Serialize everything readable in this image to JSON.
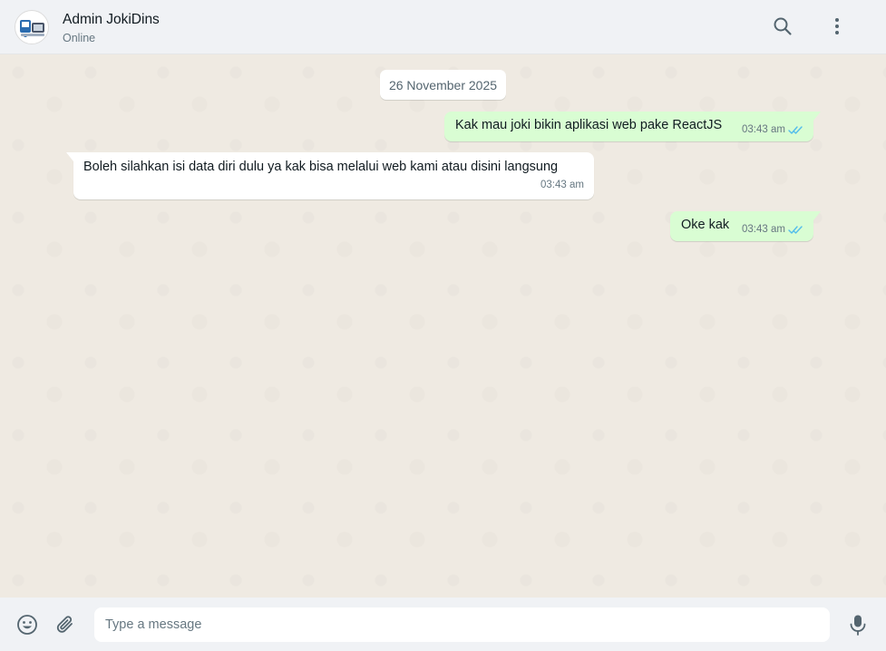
{
  "header": {
    "contact_name": "Admin JokiDins",
    "status": "Online",
    "avatar_icon": "avatar-logo-icon",
    "search_icon": "search-icon",
    "menu_icon": "kebab-menu-icon"
  },
  "chat": {
    "date_divider": "26 November 2025",
    "messages": [
      {
        "direction": "outgoing",
        "text": "Kak mau joki bikin aplikasi web pake ReactJS",
        "time": "03:43 am",
        "read": true
      },
      {
        "direction": "incoming",
        "text": "Boleh silahkan isi data diri dulu ya kak bisa melalui web kami atau disini langsung",
        "time": "03:43 am"
      },
      {
        "direction": "outgoing",
        "text": "Oke kak",
        "time": "03:43 am",
        "read": true
      }
    ]
  },
  "composer": {
    "placeholder": "Type a message",
    "value": "",
    "emoji_icon": "emoji-icon",
    "attach_icon": "paperclip-icon",
    "mic_icon": "microphone-icon"
  },
  "colors": {
    "header_bg": "#f0f2f5",
    "chat_bg": "#efeae2",
    "outgoing_bubble": "#d9fdd3",
    "incoming_bubble": "#ffffff",
    "read_tick": "#53bdeb",
    "icon_gray": "#54656f"
  }
}
